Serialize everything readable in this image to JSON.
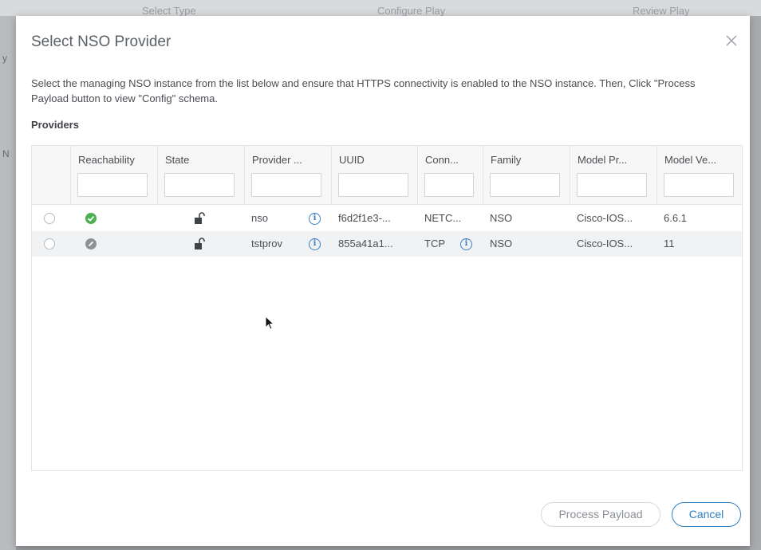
{
  "background": {
    "wizard_steps": [
      "Select Type",
      "Configure Play",
      "Review Play"
    ],
    "side_letters": [
      "y",
      "N"
    ]
  },
  "dialog": {
    "title": "Select NSO Provider",
    "close_icon": "close-icon",
    "description": "Select the managing NSO instance from the list below and ensure that HTTPS connectivity is enabled to the NSO instance. Then, Click \"Process Payload button to view \"Config\" schema.",
    "section_label": "Providers"
  },
  "table": {
    "columns": [
      "Reachability",
      "State",
      "Provider ...",
      "UUID",
      "Conn...",
      "Family",
      "Model Pr...",
      "Model Ve..."
    ],
    "rows": [
      {
        "reachability": "reachable",
        "reachability_color": "#4caf50",
        "state_icon": "unlock-icon",
        "provider": "nso",
        "uuid": "f6d2f1e3-...",
        "connection": "NETC...",
        "connection_info": false,
        "family": "NSO",
        "model_prefix": "Cisco-IOS...",
        "model_version": "6.6.1"
      },
      {
        "reachability": "unreachable",
        "reachability_color": "#8e9196",
        "state_icon": "unlock-icon",
        "provider": "tstprov",
        "uuid": "855a41a1...",
        "connection": "TCP",
        "connection_info": true,
        "family": "NSO",
        "model_prefix": "Cisco-IOS...",
        "model_version": "11"
      }
    ]
  },
  "footer": {
    "process_label": "Process Payload",
    "cancel_label": "Cancel"
  },
  "colors": {
    "accent": "#2f7fbf",
    "info": "#3b7fc4"
  }
}
